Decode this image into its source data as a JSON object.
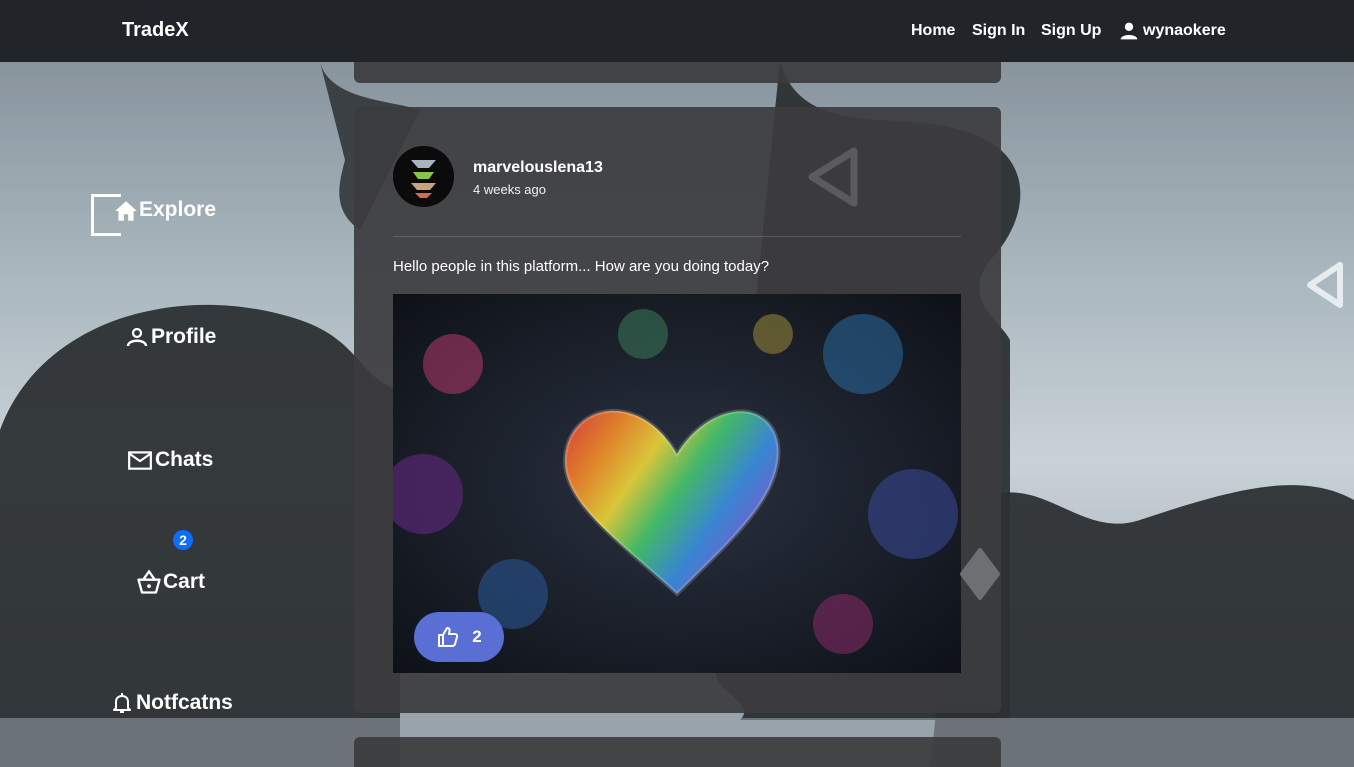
{
  "navbar": {
    "brand": "TradeX",
    "links": {
      "home": "Home",
      "sign_in": "Sign In",
      "sign_up": "Sign Up"
    },
    "user": "wynaokere",
    "user_icon": "person-icon"
  },
  "sidebar": {
    "items": [
      {
        "label": "Explore",
        "icon": "home-icon"
      },
      {
        "label": "Profile",
        "icon": "person-icon"
      },
      {
        "label": "Chats",
        "icon": "mail-icon"
      },
      {
        "label": "Cart",
        "icon": "basket-icon",
        "badge": "2"
      },
      {
        "label": "Notfcatns",
        "icon": "bell-icon"
      }
    ]
  },
  "post": {
    "username": "marvelouslena13",
    "timestamp": "4 weeks ago",
    "text": "Hello people in this platform... How are you doing today?",
    "image_subject": "rainbow chalk heart",
    "likes": "2",
    "like_icon": "thumbs-up-icon"
  },
  "colors": {
    "navbar": "#212529",
    "card": "#3c3c3e",
    "like_button": "#5a6fd3",
    "badge": "#0d6efd"
  }
}
